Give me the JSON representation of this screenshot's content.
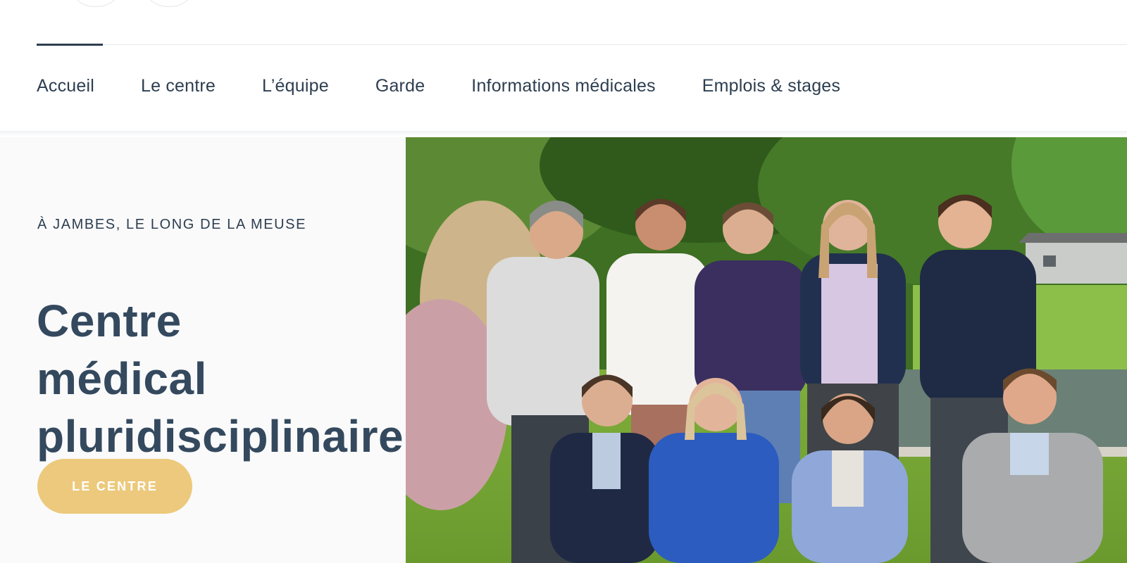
{
  "nav": {
    "items": [
      {
        "label": "Accueil"
      },
      {
        "label": "Le centre"
      },
      {
        "label": "L’équipe"
      },
      {
        "label": "Garde"
      },
      {
        "label": "Informations médicales"
      },
      {
        "label": "Emplois & stages"
      }
    ],
    "active_index": 0
  },
  "hero": {
    "eyebrow": "À JAMBES, LE LONG DE LA MEUSE",
    "title_lines": [
      "Centre",
      "médical",
      "pluridisciplinaire"
    ],
    "cta_label": "LE CENTRE",
    "photo_icon": "team-photo"
  },
  "colors": {
    "text": "#2d3e50",
    "accent": "#ecc97c",
    "hero_bg": "#fafafb"
  }
}
